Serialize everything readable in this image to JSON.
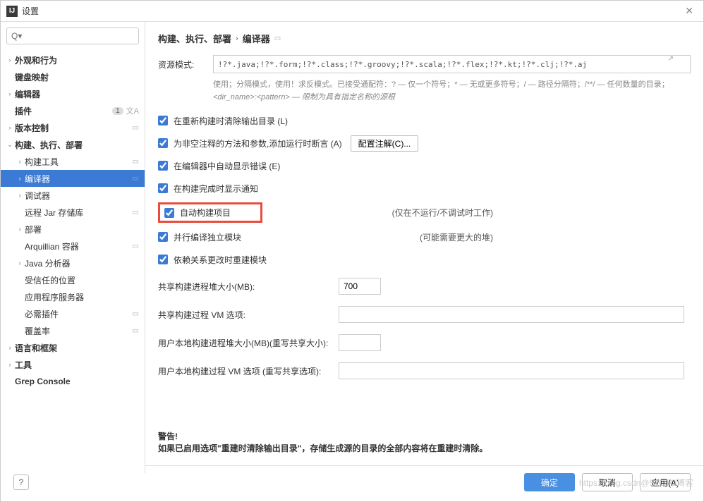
{
  "window": {
    "title": "设置"
  },
  "search": {
    "placeholder": "Q▾"
  },
  "sidebar": {
    "items": [
      {
        "label": "外观和行为",
        "arrow": "›",
        "bold": true,
        "tag": false,
        "badge": "",
        "langIcon": false,
        "indent": 0
      },
      {
        "label": "键盘映射",
        "arrow": "",
        "bold": true,
        "tag": false,
        "badge": "",
        "langIcon": false,
        "indent": 0
      },
      {
        "label": "编辑器",
        "arrow": "›",
        "bold": true,
        "tag": false,
        "badge": "",
        "langIcon": false,
        "indent": 0
      },
      {
        "label": "插件",
        "arrow": "",
        "bold": true,
        "tag": false,
        "badge": "1",
        "langIcon": true,
        "indent": 0
      },
      {
        "label": "版本控制",
        "arrow": "›",
        "bold": true,
        "tag": true,
        "badge": "",
        "langIcon": false,
        "indent": 0
      },
      {
        "label": "构建、执行、部署",
        "arrow": "⌄",
        "bold": true,
        "tag": false,
        "badge": "",
        "langIcon": false,
        "indent": 0
      },
      {
        "label": "构建工具",
        "arrow": "›",
        "bold": false,
        "tag": true,
        "badge": "",
        "langIcon": false,
        "indent": 1
      },
      {
        "label": "编译器",
        "arrow": "›",
        "bold": false,
        "tag": true,
        "badge": "",
        "langIcon": false,
        "indent": 1,
        "selected": true
      },
      {
        "label": "调试器",
        "arrow": "›",
        "bold": false,
        "tag": false,
        "badge": "",
        "langIcon": false,
        "indent": 1
      },
      {
        "label": "远程 Jar 存储库",
        "arrow": "",
        "bold": false,
        "tag": true,
        "badge": "",
        "langIcon": false,
        "indent": 1
      },
      {
        "label": "部署",
        "arrow": "›",
        "bold": false,
        "tag": false,
        "badge": "",
        "langIcon": false,
        "indent": 1
      },
      {
        "label": "Arquillian 容器",
        "arrow": "",
        "bold": false,
        "tag": true,
        "badge": "",
        "langIcon": false,
        "indent": 1
      },
      {
        "label": "Java 分析器",
        "arrow": "›",
        "bold": false,
        "tag": false,
        "badge": "",
        "langIcon": false,
        "indent": 1
      },
      {
        "label": "受信任的位置",
        "arrow": "",
        "bold": false,
        "tag": false,
        "badge": "",
        "langIcon": false,
        "indent": 1
      },
      {
        "label": "应用程序服务器",
        "arrow": "",
        "bold": false,
        "tag": false,
        "badge": "",
        "langIcon": false,
        "indent": 1
      },
      {
        "label": "必需插件",
        "arrow": "",
        "bold": false,
        "tag": true,
        "badge": "",
        "langIcon": false,
        "indent": 1
      },
      {
        "label": "覆盖率",
        "arrow": "",
        "bold": false,
        "tag": true,
        "badge": "",
        "langIcon": false,
        "indent": 1
      },
      {
        "label": "语言和框架",
        "arrow": "›",
        "bold": true,
        "tag": false,
        "badge": "",
        "langIcon": false,
        "indent": 0
      },
      {
        "label": "工具",
        "arrow": "›",
        "bold": true,
        "tag": false,
        "badge": "",
        "langIcon": false,
        "indent": 0
      },
      {
        "label": "Grep Console",
        "arrow": "",
        "bold": true,
        "tag": false,
        "badge": "",
        "langIcon": false,
        "indent": 0
      }
    ]
  },
  "breadcrumb": {
    "part1": "构建、执行、部署",
    "sep": "›",
    "part2": "编译器"
  },
  "form": {
    "resource_label": "资源模式:",
    "resource_value": "!?*.java;!?*.form;!?*.class;!?*.groovy;!?*.scala;!?*.flex;!?*.kt;!?*.clj;!?*.aj",
    "help1": "使用；分隔模式，使用！求反模式。已接受通配符：? — 仅一个符号；* — 无或更多符号；/ — 路径分隔符；/**/ — 任何数量的目录；",
    "help2": "<dir_name>:<pattern> — 限制为具有指定名称的源根",
    "cb1": "在重新构建时清除输出目录 (L)",
    "cb2": "为非空注释的方法和参数,添加运行时断言 (A)",
    "cb2_btn": "配置注解(C)...",
    "cb3": "在编辑器中自动显示错误 (E)",
    "cb4": "在构建完成时显示通知",
    "cb5": "自动构建项目",
    "cb5_note": "(仅在不运行/不调试时工作)",
    "cb6": "并行编译独立模块",
    "cb6_note": "(可能需要更大的堆)",
    "cb7": "依赖关系更改时重建模块",
    "heap_label": "共享构建进程堆大小(MB):",
    "heap_value": "700",
    "vm_label": "共享构建过程 VM 选项:",
    "user_heap_label": "用户本地构建进程堆大小(MB)(重写共享大小):",
    "user_vm_label": "用户本地构建过程 VM 选项 (重写共享选项):",
    "warning_title": "警告!",
    "warning_text": "如果已启用选项\"重建时清除输出目录\"，存储生成源的目录的全部内容将在重建时清除。"
  },
  "footer": {
    "ok": "确定",
    "cancel": "取消",
    "apply": "应用(A)"
  },
  "watermark": "https://blog.csdn@51CTO博客"
}
